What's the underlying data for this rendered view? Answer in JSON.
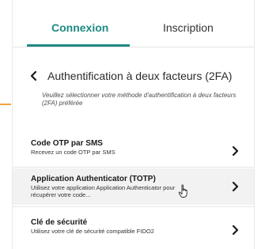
{
  "tabs": {
    "login": "Connexion",
    "signup": "Inscription"
  },
  "header": {
    "title": "Authentification à deux facteurs (2FA)",
    "subtitle": "Veuillez sélectionner votre méthode d'authentification à deux facteurs (2FA) préférée"
  },
  "methods": [
    {
      "title": "Code OTP par SMS",
      "description": "Recevez un code OTP par SMS"
    },
    {
      "title": "Application Authenticator (TOTP)",
      "description": "Utilisez votre application Application Authenticator pour récupérer votre code..."
    },
    {
      "title": "Clé de sécurité",
      "description": "Utilisez votre clé de sécurité compatible FIDO2"
    }
  ],
  "colors": {
    "accent": "#1f8a83",
    "orange": "#f2a33a",
    "highlight": "#f2f2f2"
  },
  "icons": {
    "back": "chevron-left-icon",
    "row": "chevron-right-icon",
    "cursor": "hand-pointer-icon"
  }
}
